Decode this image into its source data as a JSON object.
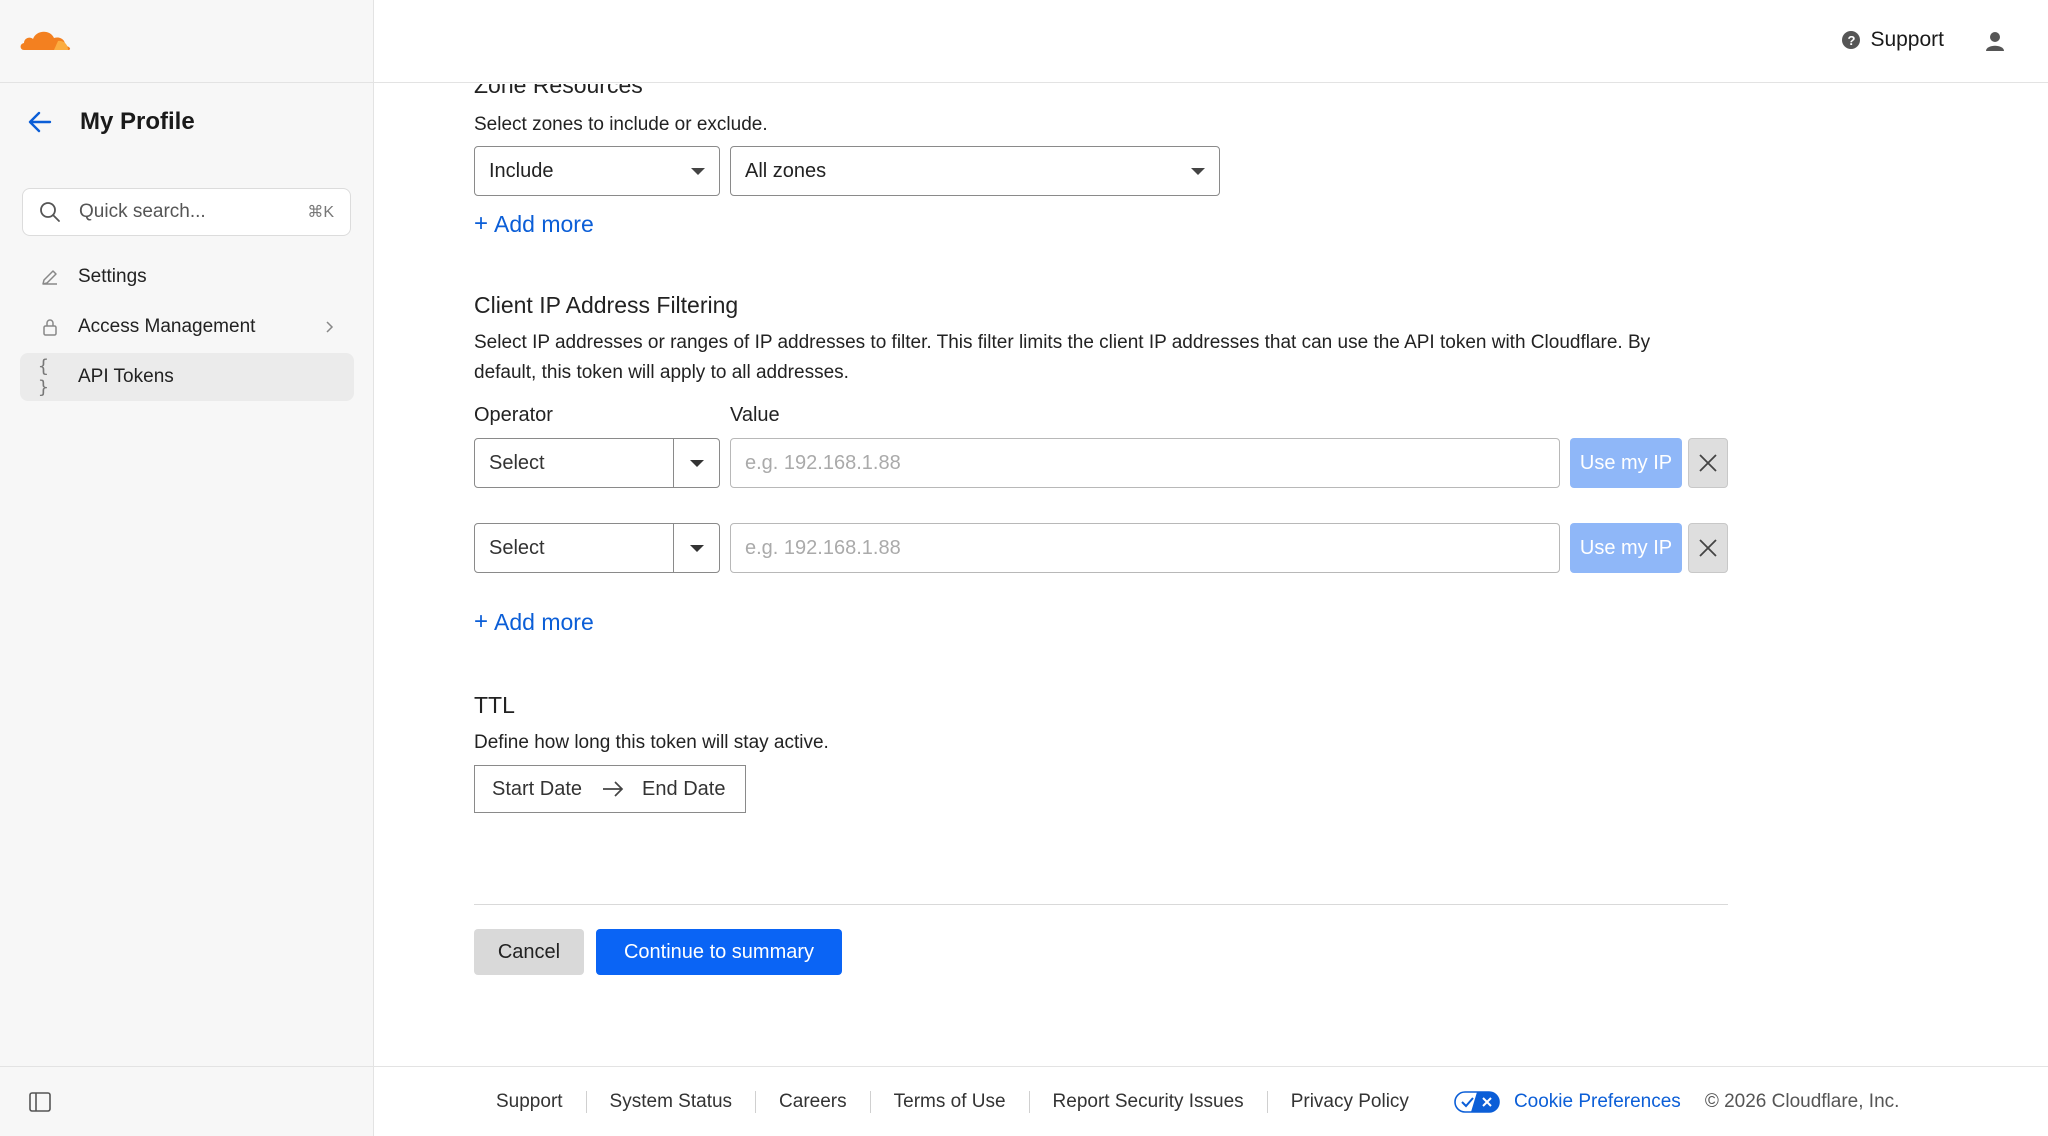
{
  "header": {
    "support_label": "Support"
  },
  "sidebar": {
    "title": "My Profile",
    "search_placeholder": "Quick search...",
    "search_shortcut": "⌘K",
    "items": [
      {
        "label": "Settings",
        "icon": "pencil-icon"
      },
      {
        "label": "Access Management",
        "icon": "lock-icon"
      },
      {
        "label": "API Tokens",
        "icon": "braces-icon",
        "active": true
      }
    ]
  },
  "zone_resources": {
    "title": "Zone Resources",
    "description": "Select zones to include or exclude.",
    "include_value": "Include",
    "zones_value": "All zones",
    "add_more": "Add more"
  },
  "ip_filtering": {
    "title": "Client IP Address Filtering",
    "description": "Select IP addresses or ranges of IP addresses to filter. This filter limits the client IP addresses that can use the API token with Cloudflare. By default, this token will apply to all addresses.",
    "operator_label": "Operator",
    "value_label": "Value",
    "rows": [
      {
        "operator": "Select",
        "value_placeholder": "e.g. 192.168.1.88",
        "use_ip_label": "Use my IP"
      },
      {
        "operator": "Select",
        "value_placeholder": "e.g. 192.168.1.88",
        "use_ip_label": "Use my IP"
      }
    ],
    "add_more": "Add more"
  },
  "ttl": {
    "title": "TTL",
    "description": "Define how long this token will stay active.",
    "start_label": "Start Date",
    "end_label": "End Date"
  },
  "actions": {
    "cancel": "Cancel",
    "continue": "Continue to summary"
  },
  "footer": {
    "links": [
      "Support",
      "System Status",
      "Careers",
      "Terms of Use",
      "Report Security Issues",
      "Privacy Policy"
    ],
    "cookie": "Cookie Preferences",
    "copyright": "© 2026 Cloudflare, Inc."
  },
  "colors": {
    "brand_orange": "#f38020",
    "primary_blue": "#0a64f5",
    "link_blue": "#0b5ed7",
    "disabled_blue": "#8fb7f8"
  }
}
